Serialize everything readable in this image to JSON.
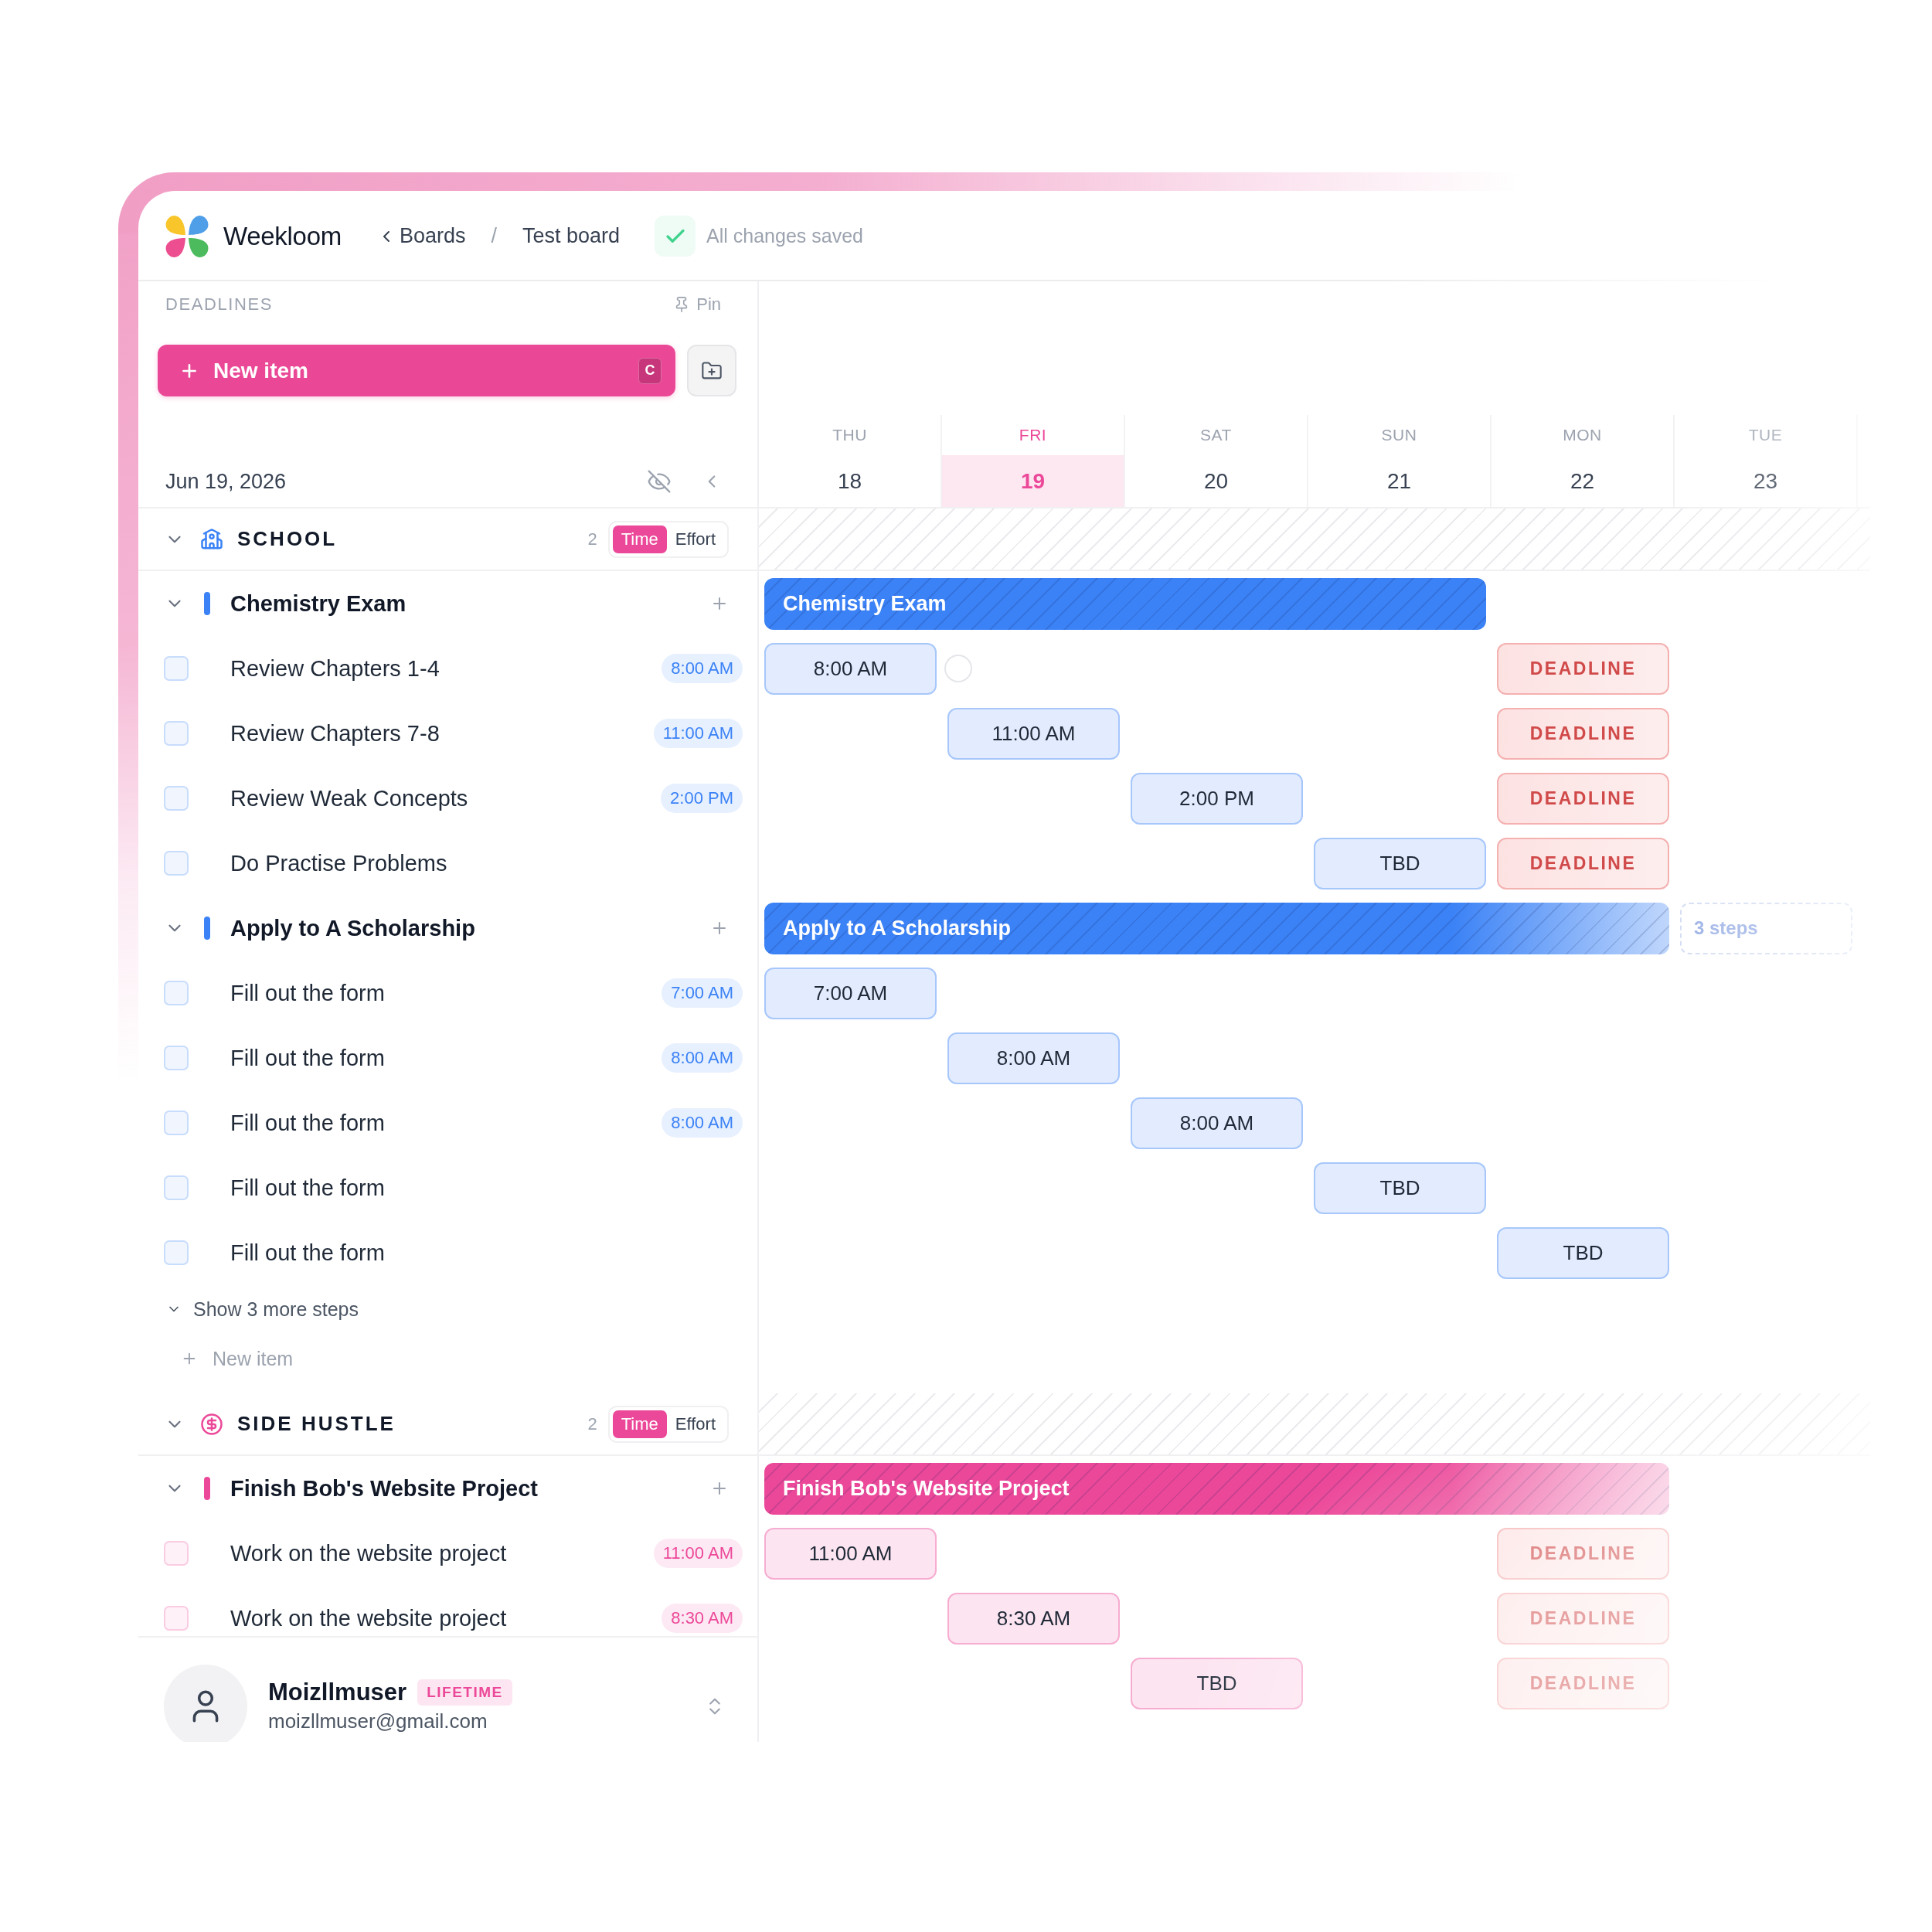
{
  "header": {
    "app_name": "Weekloom",
    "back_link": "Boards",
    "separator": "/",
    "board": "Test board",
    "save_status": "All changes saved"
  },
  "sidebar": {
    "title": "DEADLINES",
    "pin": "Pin",
    "new_item": {
      "label": "New item",
      "shortcut": "C"
    },
    "date": "Jun 19, 2026"
  },
  "days": [
    {
      "name": "THU",
      "date": "18",
      "selected": false
    },
    {
      "name": "FRI",
      "date": "19",
      "selected": true
    },
    {
      "name": "SAT",
      "date": "20",
      "selected": false
    },
    {
      "name": "SUN",
      "date": "21",
      "selected": false
    },
    {
      "name": "MON",
      "date": "22",
      "selected": false
    },
    {
      "name": "TUE",
      "date": "23",
      "selected": false
    }
  ],
  "groups": [
    {
      "name": "SCHOOL",
      "color": "#3b82f6",
      "count": "2",
      "expanded": true,
      "modes": [
        {
          "label": "Time",
          "selected": true
        },
        {
          "label": "Effort",
          "selected": false
        }
      ],
      "items": [
        {
          "title": "Chemistry Exam",
          "expanded": true,
          "bar_cells": [
            {
              "kind": "bar",
              "text": "Chemistry Exam"
            },
            {
              "kind": "bar"
            },
            {
              "kind": "bar"
            },
            {
              "kind": "bar"
            },
            {
              "kind": "empty"
            },
            {
              "kind": "empty"
            }
          ],
          "steps": [
            {
              "title": "Review Chapters 1-4",
              "checked": false,
              "time": "8:00 AM",
              "cells": [
                {
                  "kind": "time",
                  "text": "8:00 AM"
                },
                {
                  "kind": "ring"
                },
                {
                  "kind": "empty"
                },
                {
                  "kind": "empty"
                },
                {
                  "kind": "deadline",
                  "text": "DEADLINE"
                },
                {
                  "kind": "empty"
                }
              ]
            },
            {
              "title": "Review Chapters 7-8",
              "checked": false,
              "time": "11:00 AM",
              "cells": [
                {
                  "kind": "empty"
                },
                {
                  "kind": "time",
                  "text": "11:00 AM"
                },
                {
                  "kind": "empty"
                },
                {
                  "kind": "empty"
                },
                {
                  "kind": "deadline",
                  "text": "DEADLINE"
                },
                {
                  "kind": "empty"
                }
              ]
            },
            {
              "title": "Review Weak Concepts",
              "checked": false,
              "time": "2:00 PM",
              "cells": [
                {
                  "kind": "empty"
                },
                {
                  "kind": "empty"
                },
                {
                  "kind": "time",
                  "text": "2:00 PM"
                },
                {
                  "kind": "empty"
                },
                {
                  "kind": "deadline",
                  "text": "DEADLINE"
                },
                {
                  "kind": "empty"
                }
              ]
            },
            {
              "title": "Do Practise Problems",
              "checked": false,
              "cells": [
                {
                  "kind": "empty"
                },
                {
                  "kind": "empty"
                },
                {
                  "kind": "empty"
                },
                {
                  "kind": "time",
                  "text": "TBD"
                },
                {
                  "kind": "deadline",
                  "text": "DEADLINE"
                },
                {
                  "kind": "empty"
                }
              ]
            }
          ]
        },
        {
          "title": "Apply to A Scholarship",
          "expanded": true,
          "bar_cells": [
            {
              "kind": "bar",
              "text": "Apply to A Scholarship"
            },
            {
              "kind": "bar"
            },
            {
              "kind": "bar"
            },
            {
              "kind": "bar"
            },
            {
              "kind": "fade"
            },
            {
              "kind": "more",
              "text": "3 steps"
            }
          ],
          "steps": [
            {
              "title": "Fill out the form",
              "checked": false,
              "time": "7:00 AM",
              "cells": [
                {
                  "kind": "time",
                  "text": "7:00 AM"
                },
                {
                  "kind": "empty"
                },
                {
                  "kind": "empty"
                },
                {
                  "kind": "empty"
                },
                {
                  "kind": "empty"
                },
                {
                  "kind": "empty"
                }
              ]
            },
            {
              "title": "Fill out the form",
              "checked": false,
              "time": "8:00 AM",
              "cells": [
                {
                  "kind": "empty"
                },
                {
                  "kind": "time",
                  "text": "8:00 AM"
                },
                {
                  "kind": "empty"
                },
                {
                  "kind": "empty"
                },
                {
                  "kind": "empty"
                },
                {
                  "kind": "empty"
                }
              ]
            },
            {
              "title": "Fill out the form",
              "checked": false,
              "time": "8:00 AM",
              "cells": [
                {
                  "kind": "empty"
                },
                {
                  "kind": "empty"
                },
                {
                  "kind": "time",
                  "text": "8:00 AM"
                },
                {
                  "kind": "empty"
                },
                {
                  "kind": "empty"
                },
                {
                  "kind": "empty"
                }
              ]
            },
            {
              "title": "Fill out the form",
              "checked": false,
              "cells": [
                {
                  "kind": "empty"
                },
                {
                  "kind": "empty"
                },
                {
                  "kind": "empty"
                },
                {
                  "kind": "time",
                  "text": "TBD"
                },
                {
                  "kind": "empty"
                },
                {
                  "kind": "empty"
                }
              ]
            },
            {
              "title": "Fill out the form",
              "checked": false,
              "cells": [
                {
                  "kind": "empty"
                },
                {
                  "kind": "empty"
                },
                {
                  "kind": "empty"
                },
                {
                  "kind": "empty"
                },
                {
                  "kind": "time",
                  "text": "TBD"
                },
                {
                  "kind": "empty"
                }
              ]
            }
          ]
        }
      ],
      "show_more": "Show 3 more steps",
      "add_item": "New item"
    },
    {
      "name": "SIDE HUSTLE",
      "color": "#ec4899",
      "count": "2",
      "expanded": true,
      "modes": [
        {
          "label": "Time",
          "selected": true
        },
        {
          "label": "Effort",
          "selected": false
        }
      ],
      "items": [
        {
          "title": "Finish Bob's Website Project",
          "expanded": true,
          "bar_cells": [
            {
              "kind": "bar",
              "text": "Finish Bob's Website Project"
            },
            {
              "kind": "bar"
            },
            {
              "kind": "bar"
            },
            {
              "kind": "bar"
            },
            {
              "kind": "fade"
            },
            {
              "kind": "empty"
            }
          ],
          "steps": [
            {
              "title": "Work on the website project",
              "checked": false,
              "time": "11:00 AM",
              "cells": [
                {
                  "kind": "time",
                  "text": "11:00 AM"
                },
                {
                  "kind": "empty"
                },
                {
                  "kind": "empty"
                },
                {
                  "kind": "empty"
                },
                {
                  "kind": "deadline",
                  "text": "DEADLINE"
                },
                {
                  "kind": "empty"
                }
              ]
            },
            {
              "title": "Work on the website project",
              "checked": false,
              "time": "8:30 AM",
              "cells": [
                {
                  "kind": "empty"
                },
                {
                  "kind": "time",
                  "text": "8:30 AM"
                },
                {
                  "kind": "empty"
                },
                {
                  "kind": "empty"
                },
                {
                  "kind": "deadline",
                  "text": "DEADLINE"
                },
                {
                  "kind": "empty"
                }
              ]
            },
            {
              "cells": [
                {
                  "kind": "empty"
                },
                {
                  "kind": "empty"
                },
                {
                  "kind": "time",
                  "text": "TBD"
                },
                {
                  "kind": "empty"
                },
                {
                  "kind": "deadline",
                  "text": "DEADLINE"
                },
                {
                  "kind": "empty"
                }
              ]
            }
          ]
        }
      ]
    }
  ],
  "user": {
    "name": "Moizllmuser",
    "plan": "LIFETIME",
    "email": "moizllmuser@gmail.com"
  }
}
